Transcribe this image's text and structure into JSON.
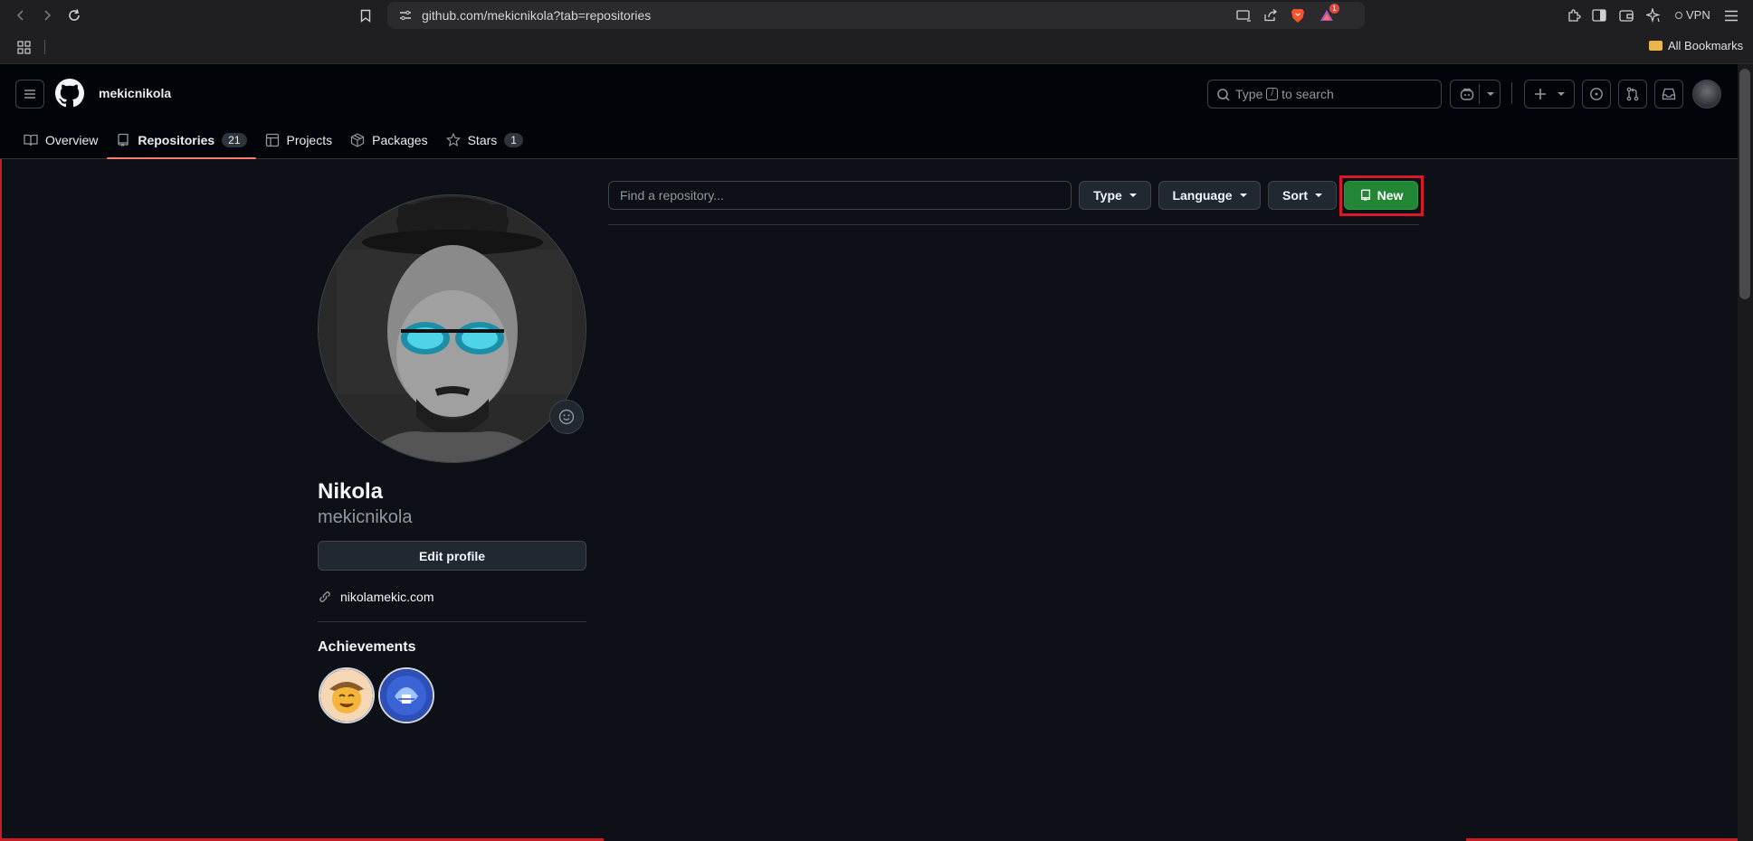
{
  "browser": {
    "url": "github.com/mekicnikola?tab=repositories",
    "vpn_label": "VPN",
    "bookmarks_label": "All Bookmarks",
    "notification_count": "1"
  },
  "header": {
    "username": "mekicnikola",
    "search_prefix": "Type",
    "search_key": "/",
    "search_suffix": "to search"
  },
  "tabs": [
    {
      "label": "Overview",
      "icon": "book-icon"
    },
    {
      "label": "Repositories",
      "count": "21",
      "icon": "repo-icon"
    },
    {
      "label": "Projects",
      "icon": "table-icon"
    },
    {
      "label": "Packages",
      "icon": "package-icon"
    },
    {
      "label": "Stars",
      "count": "1",
      "icon": "star-icon"
    }
  ],
  "profile": {
    "name": "Nikola",
    "login": "mekicnikola",
    "edit_label": "Edit profile",
    "website": "nikolamekic.com",
    "achievements_title": "Achievements"
  },
  "repos": {
    "search_placeholder": "Find a repository...",
    "type_label": "Type",
    "language_label": "Language",
    "sort_label": "Sort",
    "new_label": "New"
  },
  "colors": {
    "accent_tab": "#f78166",
    "new_button": "#238636",
    "highlight": "#d8192a"
  }
}
